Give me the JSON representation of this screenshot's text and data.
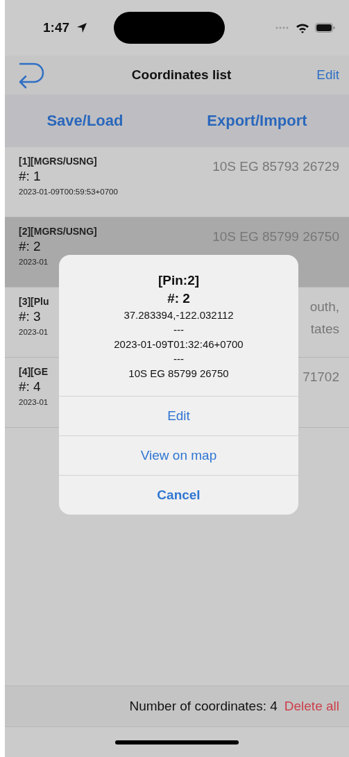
{
  "status_bar": {
    "time": "1:47"
  },
  "nav_bar": {
    "title": "Coordinates list",
    "edit": "Edit"
  },
  "toolbar": {
    "buttons": [
      "Save/Load",
      "Export/Import"
    ]
  },
  "rows": [
    {
      "tag": "[1][MGRS/USNG]",
      "number": "#: 1",
      "date": "2023-01-09T00:59:53+0700",
      "value": [
        "10S EG 85793 26729"
      ],
      "selected": false
    },
    {
      "tag": "[2][MGRS/USNG]",
      "number": "#: 2",
      "date": "2023-01",
      "value": [
        "10S EG 85799 26750"
      ],
      "selected": true
    },
    {
      "tag": "[3][Plu",
      "number": "#: 3",
      "date": "2023-01",
      "value": [
        "outh,",
        "tates"
      ],
      "selected": false
    },
    {
      "tag": "[4][GE",
      "number": "#: 4",
      "date": "2023-01",
      "value": [
        "71702"
      ],
      "selected": false
    }
  ],
  "alert": {
    "title": "[Pin:2]",
    "number": "#: 2",
    "lines": [
      "37.283394,-122.032112",
      "---",
      "2023-01-09T01:32:46+0700",
      "---",
      "10S EG 85799 26750"
    ],
    "actions": [
      {
        "label": "Edit",
        "kind": "default"
      },
      {
        "label": "View on map",
        "kind": "default"
      },
      {
        "label": "Cancel",
        "kind": "cancel"
      }
    ]
  },
  "footer": {
    "count": "Number of coordinates: 4",
    "delete": "Delete all"
  }
}
